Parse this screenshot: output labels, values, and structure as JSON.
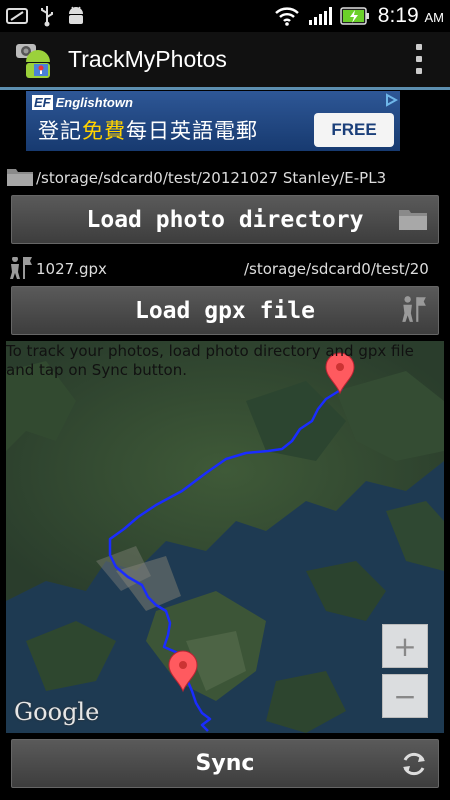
{
  "status_bar": {
    "time": "8:19",
    "ampm": "AM",
    "icons": [
      "screenshot-icon",
      "usb-icon",
      "android-debug-icon",
      "wifi-icon",
      "signal-icon",
      "battery-charging-icon"
    ]
  },
  "action_bar": {
    "title": "TrackMyPhotos",
    "overflow_icon": "overflow-menu-icon"
  },
  "ad": {
    "brand": "Englishtown",
    "brand_mark": "EF",
    "text_before": "登記",
    "text_highlight": "免費",
    "text_after": "每日英語電郵",
    "button": "FREE"
  },
  "photo_directory": {
    "path": "/storage/sdcard0/test/20121027 Stanley/E-PL3",
    "button_label": "Load photo directory",
    "icon": "folder-icon"
  },
  "gpx": {
    "file_name": "1027.gpx",
    "file_path": "/storage/sdcard0/test/20",
    "button_label": "Load gpx file",
    "icon": "hiker-flag-icon"
  },
  "map": {
    "hint": "To track your photos, load photo directory and gpx file and tap on Sync button.",
    "zoom_in": "+",
    "zoom_out": "−",
    "attribution": "Google"
  },
  "sync": {
    "button_label": "Sync",
    "icon": "refresh-icon"
  },
  "colors": {
    "accent": "#5d8fb0",
    "track": "#1a2cff",
    "marker": "#ff5a5f"
  }
}
